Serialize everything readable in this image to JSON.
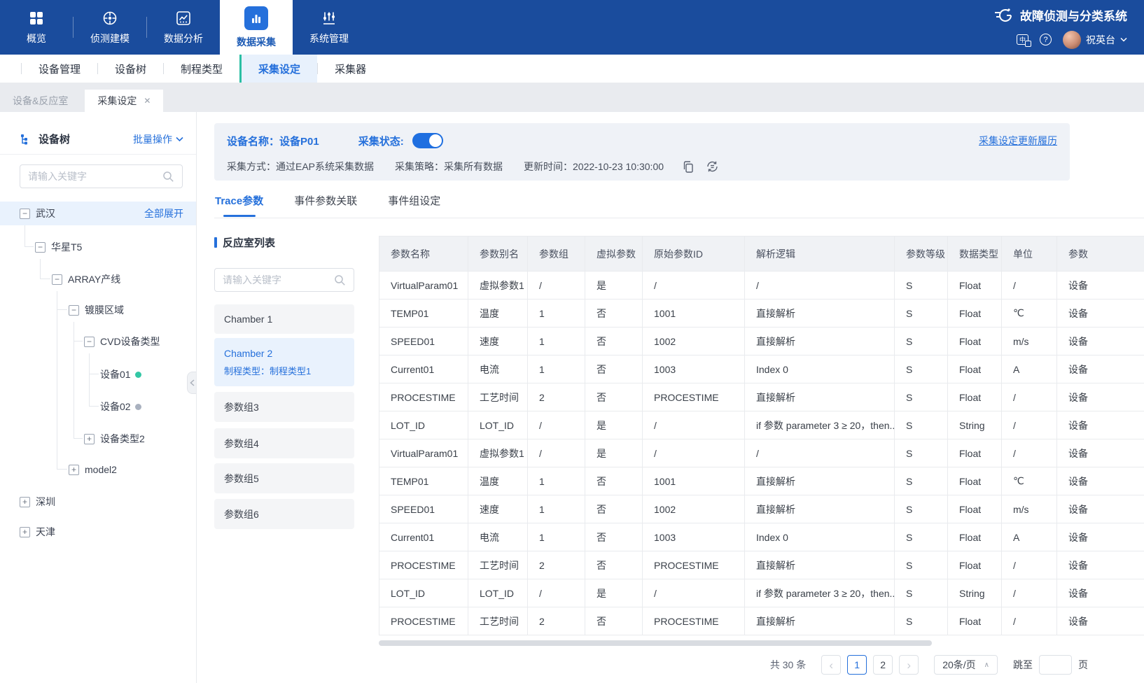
{
  "top_nav": {
    "title": "故障侦测与分类系统",
    "items": [
      {
        "label": "概览"
      },
      {
        "label": "侦测建模"
      },
      {
        "label": "数据分析"
      },
      {
        "label": "数据采集"
      },
      {
        "label": "系统管理"
      }
    ],
    "active_index": 3,
    "translate_glyph": "中",
    "help_glyph": "?",
    "user_name": "祝英台"
  },
  "sub_nav": {
    "items": [
      {
        "label": "设备管理"
      },
      {
        "label": "设备树"
      },
      {
        "label": "制程类型"
      },
      {
        "label": "采集设定"
      },
      {
        "label": "采集器"
      }
    ],
    "active_index": 3,
    "accent_color": "#2bbfa3"
  },
  "tab_bar": {
    "tabs": [
      {
        "label": "设备&反应室"
      },
      {
        "label": "采集设定"
      }
    ],
    "active_index": 1,
    "close_glyph": "✕"
  },
  "sidebar": {
    "title": "设备树",
    "batch_action": "批量操作",
    "search_placeholder": "请输入关键字",
    "expand_all": "全部展开",
    "tree": [
      {
        "label": "武汉",
        "sign": "−"
      },
      {
        "label": "华星T5",
        "sign": "−"
      },
      {
        "label": "ARRAY产线",
        "sign": "−"
      },
      {
        "label": "镀膜区域",
        "sign": "−"
      },
      {
        "label": "CVD设备类型",
        "sign": "−"
      },
      {
        "label": "设备01",
        "status": "online",
        "status_color": "#33c7a5"
      },
      {
        "label": "设备02",
        "status": "offline",
        "status_color": "#a9b1bf"
      },
      {
        "label": "设备类型2",
        "sign": "+"
      },
      {
        "label": "model2",
        "sign": "+"
      },
      {
        "label": "深圳",
        "sign": "+"
      },
      {
        "label": "天津",
        "sign": "+"
      }
    ]
  },
  "device_panel": {
    "name_label": "设备名称：",
    "name_value": "设备P01",
    "status_label": "采集状态:",
    "status_on": true,
    "history_link": "采集设定更新履历",
    "method": "采集方式：通过EAP系统采集数据",
    "strategy": "采集策略：采集所有数据",
    "updated": "更新时间：2022-10-23 10:30:00"
  },
  "content_tabs": {
    "items": [
      {
        "label": "Trace参数"
      },
      {
        "label": "事件参数关联"
      },
      {
        "label": "事件组设定"
      }
    ],
    "active_index": 0
  },
  "chamber_panel": {
    "title": "反应室列表",
    "search_placeholder": "请输入关键字",
    "items": [
      {
        "name": "Chamber 1"
      },
      {
        "name": "Chamber 2",
        "subtitle": "制程类型：制程类型1",
        "selected": true
      },
      {
        "name": "参数组3"
      },
      {
        "name": "参数组4"
      },
      {
        "name": "参数组5"
      },
      {
        "name": "参数组6"
      }
    ]
  },
  "table": {
    "columns": [
      "参数名称",
      "参数别名",
      "参数组",
      "虚拟参数",
      "原始参数ID",
      "解析逻辑",
      "参数等级",
      "数据类型",
      "单位",
      "参数"
    ],
    "rows": [
      [
        "VirtualParam01",
        "虚拟参数1",
        "/",
        "是",
        "/",
        "/",
        "S",
        "Float",
        "/",
        "设备"
      ],
      [
        "TEMP01",
        "温度",
        "1",
        "否",
        "1001",
        "直接解析",
        "S",
        "Float",
        "℃",
        "设备"
      ],
      [
        "SPEED01",
        "速度",
        "1",
        "否",
        "1002",
        "直接解析",
        "S",
        "Float",
        "m/s",
        "设备"
      ],
      [
        "Current01",
        "电流",
        "1",
        "否",
        "1003",
        "Index 0",
        "S",
        "Float",
        "A",
        "设备"
      ],
      [
        "PROCESTIME",
        "工艺时间",
        "2",
        "否",
        "PROCESTIME",
        "直接解析",
        "S",
        "Float",
        "/",
        "设备"
      ],
      [
        "LOT_ID",
        "LOT_ID",
        "/",
        "是",
        "/",
        "if 参数 parameter 3 ≥ 20，then...",
        "S",
        "String",
        "/",
        "设备"
      ],
      [
        "VirtualParam01",
        "虚拟参数1",
        "/",
        "是",
        "/",
        "/",
        "S",
        "Float",
        "/",
        "设备"
      ],
      [
        "TEMP01",
        "温度",
        "1",
        "否",
        "1001",
        "直接解析",
        "S",
        "Float",
        "℃",
        "设备"
      ],
      [
        "SPEED01",
        "速度",
        "1",
        "否",
        "1002",
        "直接解析",
        "S",
        "Float",
        "m/s",
        "设备"
      ],
      [
        "Current01",
        "电流",
        "1",
        "否",
        "1003",
        "Index 0",
        "S",
        "Float",
        "A",
        "设备"
      ],
      [
        "PROCESTIME",
        "工艺时间",
        "2",
        "否",
        "PROCESTIME",
        "直接解析",
        "S",
        "Float",
        "/",
        "设备"
      ],
      [
        "LOT_ID",
        "LOT_ID",
        "/",
        "是",
        "/",
        "if 参数 parameter 3 ≥ 20，then...",
        "S",
        "String",
        "/",
        "设备"
      ],
      [
        "PROCESTIME",
        "工艺时间",
        "2",
        "否",
        "PROCESTIME",
        "直接解析",
        "S",
        "Float",
        "/",
        "设备"
      ]
    ]
  },
  "pagination": {
    "total": "共 30 条",
    "prev_glyph": "‹",
    "next_glyph": "›",
    "pages": [
      "1",
      "2"
    ],
    "active_page": "1",
    "page_size": "20条/页",
    "caret_glyph": "∧",
    "jump_label": "跳至",
    "page_unit": "页"
  }
}
